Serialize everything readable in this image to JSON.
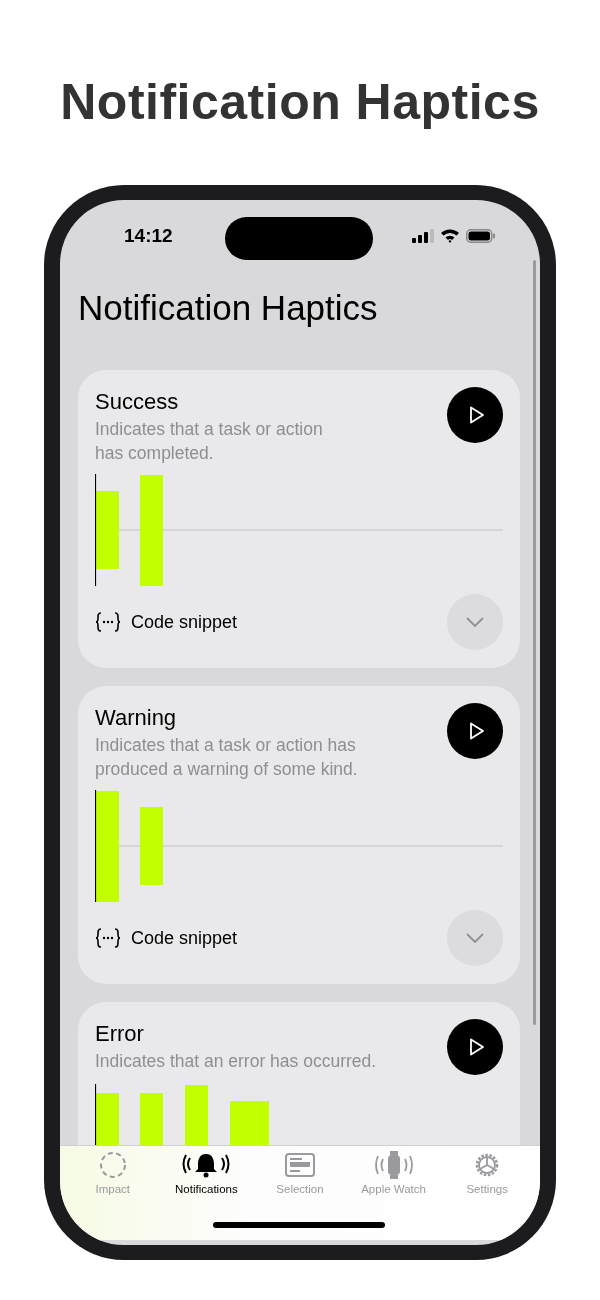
{
  "page_title": "Notification Haptics",
  "status_bar": {
    "time": "14:12"
  },
  "screen_title": "Notification Haptics",
  "cards": [
    {
      "kind": "success",
      "title": "Success",
      "description": "Indicates that a task or action\nhas completed.",
      "snippet_label": "Code snippet",
      "expanded": false
    },
    {
      "kind": "warning",
      "title": "Warning",
      "description": "Indicates that a task or action has produced a warning of some kind.",
      "snippet_label": "Code snippet",
      "expanded": false
    },
    {
      "kind": "error",
      "title": "Error",
      "description": "Indicates that an error has occurred."
    }
  ],
  "tabs": [
    {
      "kind": "impact",
      "label": "Impact",
      "selected": false
    },
    {
      "kind": "notifications",
      "label": "Notifications",
      "selected": true
    },
    {
      "kind": "selection",
      "label": "Selection",
      "selected": false
    },
    {
      "kind": "watch",
      "label": "Apple Watch",
      "selected": false
    },
    {
      "kind": "settings",
      "label": "Settings",
      "selected": false
    }
  ]
}
